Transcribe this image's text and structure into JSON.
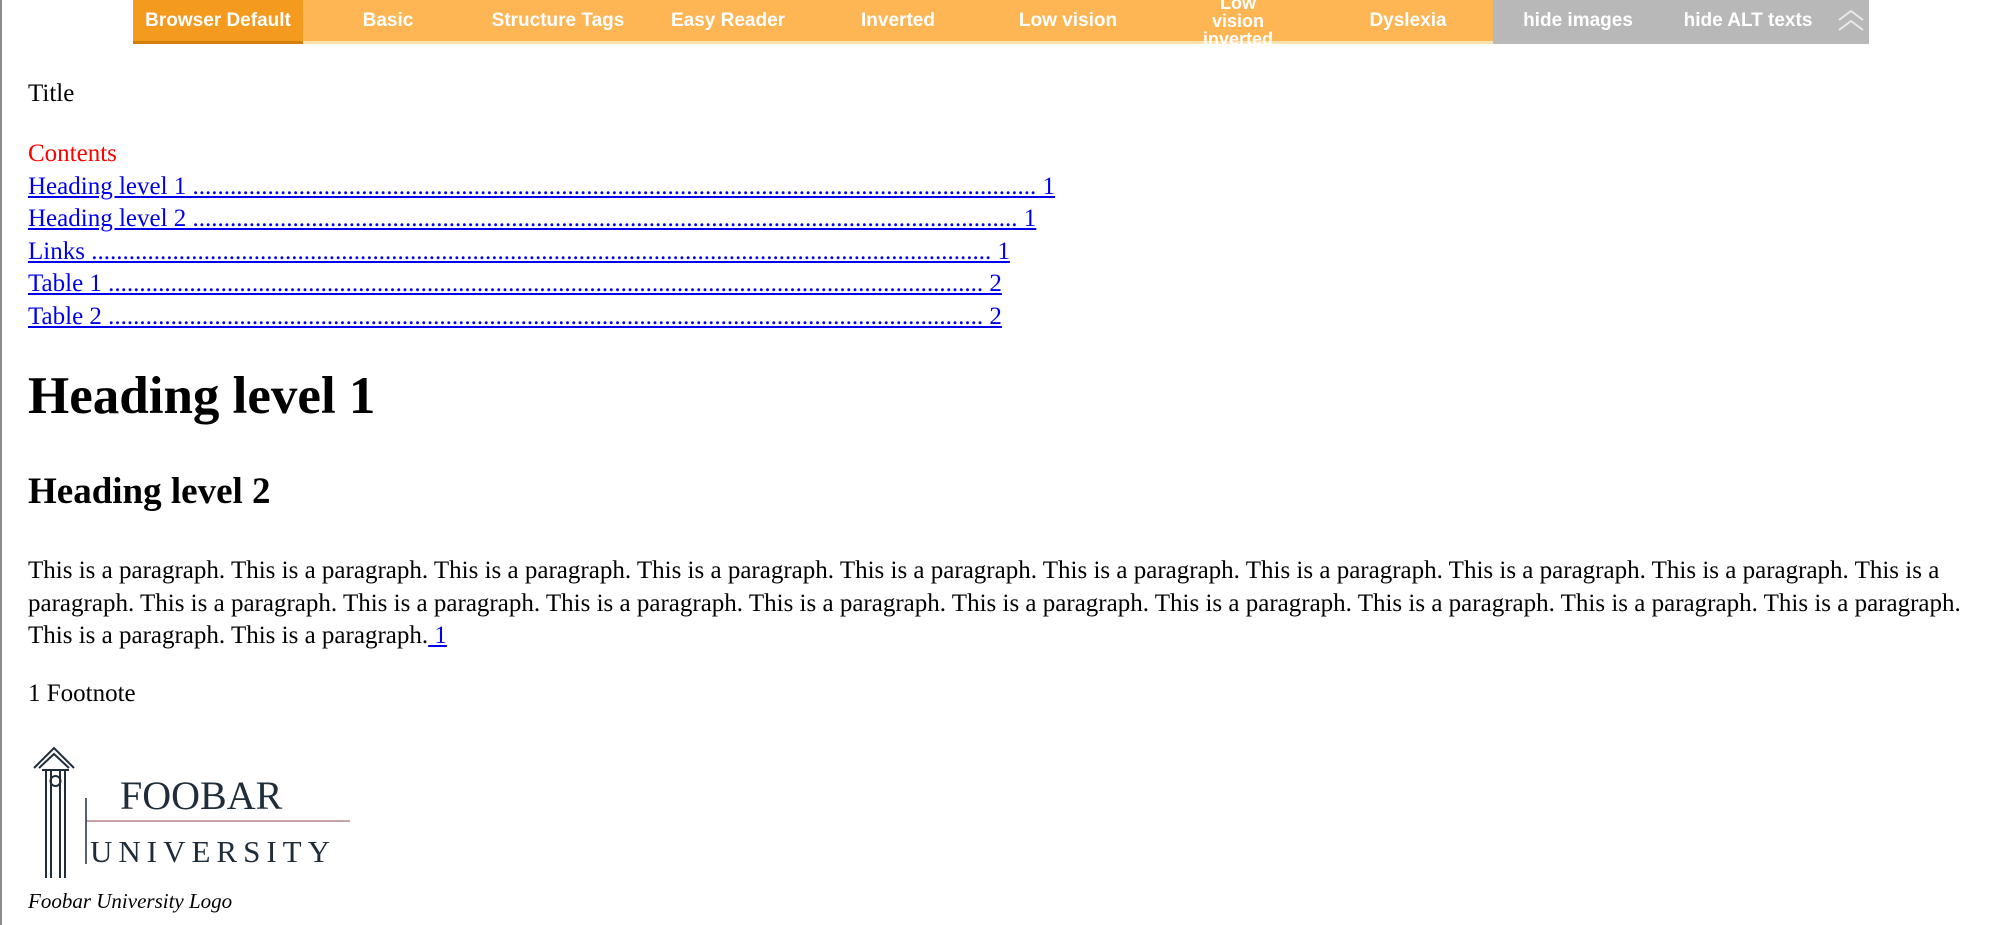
{
  "toolbar": {
    "buttons": [
      {
        "label": "Browser Default"
      },
      {
        "label": "Basic"
      },
      {
        "label": "Structure Tags"
      },
      {
        "label": "Easy Reader"
      },
      {
        "label": "Inverted"
      },
      {
        "label": "Low vision"
      },
      {
        "label": "Low vision inverted"
      },
      {
        "label": "Dyslexia"
      },
      {
        "label": "hide images"
      },
      {
        "label": "hide ALT texts"
      }
    ],
    "collapse_icon": "chevron-up-icon"
  },
  "document": {
    "title": "Title",
    "toc": {
      "heading": "Contents",
      "entries": [
        {
          "text": "Heading level 1 ....................................................................................................................................... 1"
        },
        {
          "text": "Heading level 2 .................................................................................................................................... 1"
        },
        {
          "text": "Links ................................................................................................................................................ 1"
        },
        {
          "text": "Table 1 ............................................................................................................................................ 2"
        },
        {
          "text": "Table 2 ............................................................................................................................................ 2"
        }
      ]
    },
    "heading1": "Heading level 1",
    "heading2": "Heading level 2",
    "paragraph": "This is a paragraph. This is a paragraph. This is a paragraph. This is a paragraph. This is a paragraph. This is a paragraph. This is a paragraph. This is a paragraph. This is a paragraph. This is a paragraph. This is a paragraph. This is a paragraph. This is a paragraph. This is a paragraph. This is a paragraph. This is a paragraph. This is a paragraph. This is a paragraph. This is a paragraph. This is a paragraph. This is a paragraph.",
    "footnote_ref": " 1",
    "footnote": "1 Footnote",
    "logo": {
      "line1": "FOOBAR",
      "line2": "UNIVERSITY",
      "caption": "Foobar University Logo"
    }
  }
}
